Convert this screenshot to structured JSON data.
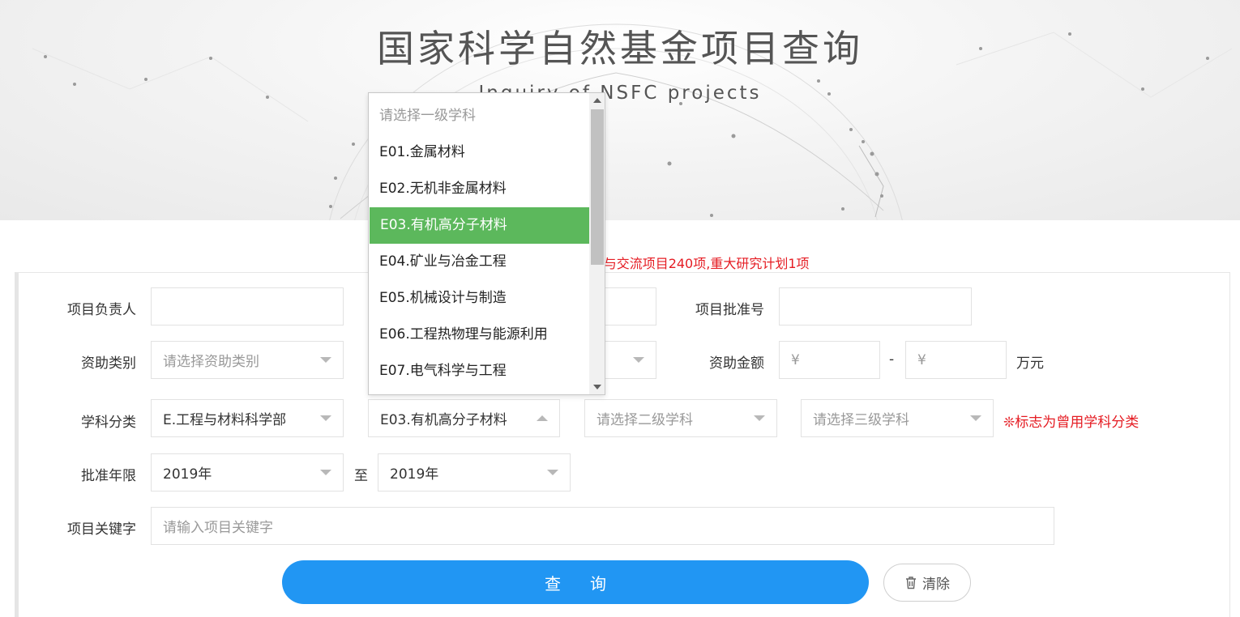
{
  "banner": {
    "title": "国家科学自然基金项目查询",
    "subtitle": "Inquiry of NSFC projects"
  },
  "notice": "新增2019年…国际(地区)合作与交流项目240项,重大研究计划1项",
  "form": {
    "pi": {
      "label": "项目负责人",
      "value": ""
    },
    "approval_no": {
      "label": "项目批准号",
      "value": ""
    },
    "funding_type": {
      "label": "资助类别",
      "placeholder": "请选择资助类别"
    },
    "amount": {
      "label": "资助金额",
      "currency_symbol": "¥",
      "separator": "-",
      "unit": "万元"
    },
    "discipline": {
      "label": "学科分类",
      "level0": "E.工程与材料科学部",
      "level1": "E03.有机高分子材料",
      "level2_placeholder": "请选择二级学科",
      "level3_placeholder": "请选择三级学科",
      "hint": "❊标志为曾用学科分类"
    },
    "years": {
      "label": "批准年限",
      "from": "2019年",
      "to_label": "至",
      "to": "2019年"
    },
    "keyword": {
      "label": "项目关键字",
      "placeholder": "请输入项目关键字"
    },
    "search_button": "查询",
    "clear_button": "清除"
  },
  "dropdown": {
    "options": [
      "请选择一级学科",
      "E01.金属材料",
      "E02.无机非金属材料",
      "E03.有机高分子材料",
      "E04.矿业与冶金工程",
      "E05.机械设计与制造",
      "E06.工程热物理与能源利用",
      "E07.电气科学与工程"
    ],
    "selected_index": 3
  },
  "colors": {
    "accent": "#2196f3",
    "selected_option": "#5cb85c",
    "warning": "#e51c23"
  }
}
